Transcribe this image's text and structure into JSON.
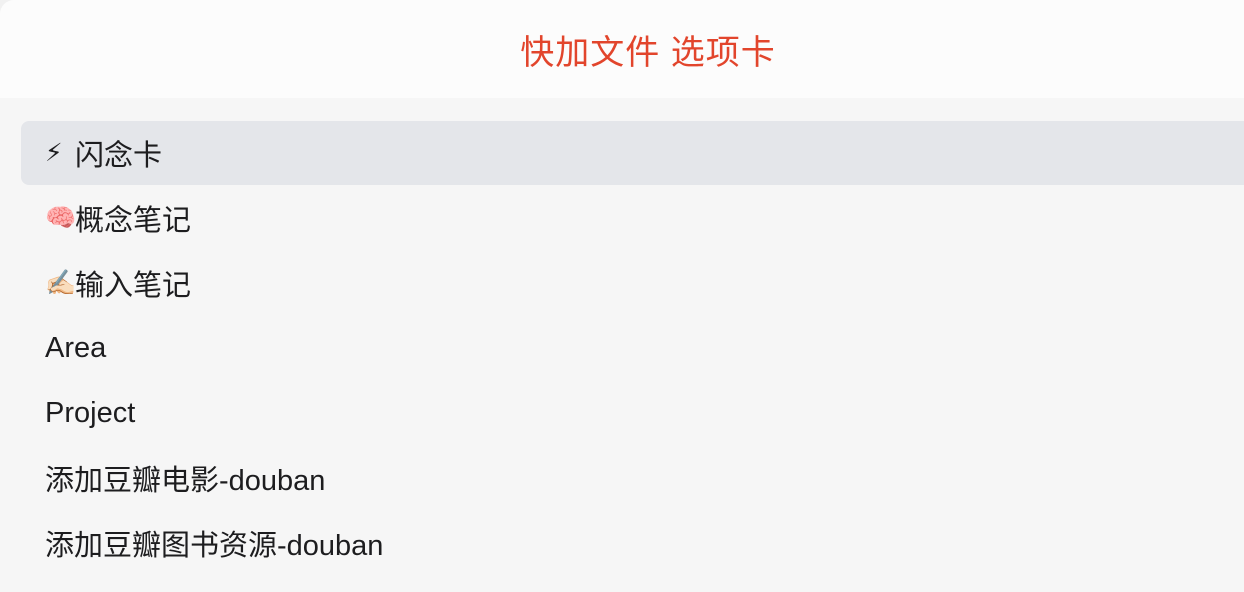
{
  "modal": {
    "title": "快加文件 选项卡"
  },
  "options": [
    {
      "emoji": "⚡",
      "label": "闪念卡",
      "selected": true
    },
    {
      "emoji": "🧠",
      "label": "概念笔记",
      "selected": false
    },
    {
      "emoji": "✍🏻",
      "label": "输入笔记",
      "selected": false
    },
    {
      "emoji": "",
      "label": "Area",
      "selected": false
    },
    {
      "emoji": "",
      "label": "Project",
      "selected": false
    },
    {
      "emoji": "",
      "label": "添加豆瓣电影-douban",
      "selected": false
    },
    {
      "emoji": "",
      "label": "添加豆瓣图书资源-douban",
      "selected": false
    }
  ],
  "colors": {
    "title_accent": "#e2452c",
    "selected_bg": "#e4e6ea"
  }
}
